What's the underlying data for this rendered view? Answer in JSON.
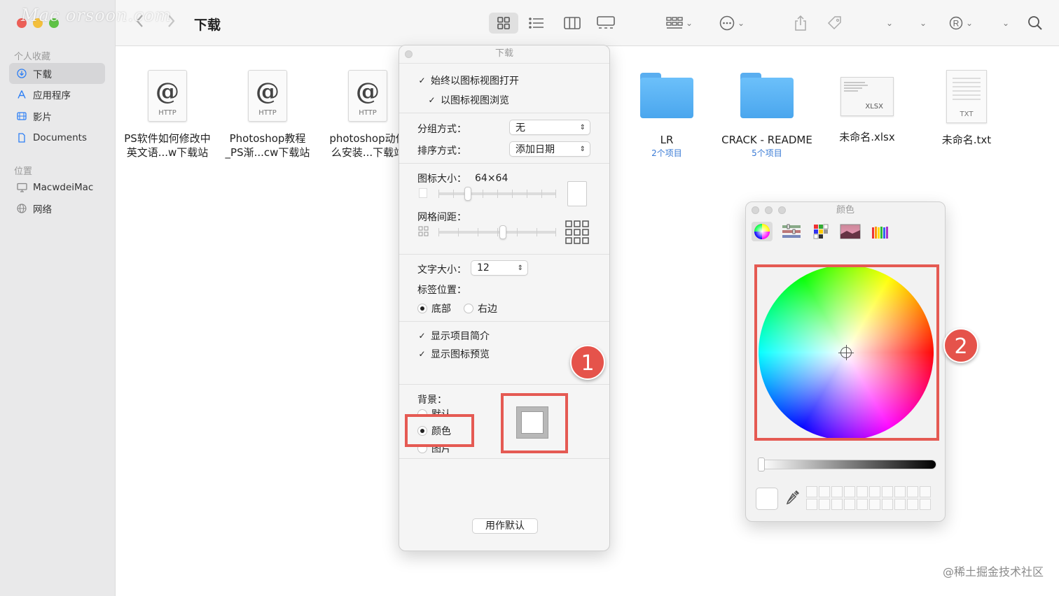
{
  "watermark": "Mac orsoon.com",
  "window": {
    "title": "下载"
  },
  "sidebar": {
    "favorites_label": "个人收藏",
    "locations_label": "位置",
    "items": [
      {
        "label": "下载",
        "icon": "download-icon"
      },
      {
        "label": "应用程序",
        "icon": "applications-icon"
      },
      {
        "label": "影片",
        "icon": "movies-icon"
      },
      {
        "label": "Documents",
        "icon": "document-icon"
      }
    ],
    "locations": [
      {
        "label": "MacwdeiMac",
        "icon": "computer-icon"
      },
      {
        "label": "网络",
        "icon": "network-icon"
      }
    ]
  },
  "toolbar": {
    "icons": [
      "icon-view-icon",
      "list-view-icon",
      "column-view-icon",
      "gallery-view-icon",
      "group-icon",
      "more-actions-icon",
      "share-icon",
      "tag-icon",
      "chevron-down-icon",
      "chevron-down-icon",
      "registered-icon",
      "chevron-down-icon",
      "search-icon"
    ]
  },
  "files": [
    {
      "name1": "PS软件如何修改中",
      "name2": "英文语...w下载站",
      "type": "HTTP"
    },
    {
      "name1": "Photoshop教程",
      "name2": "_PS渐...cw下载站",
      "type": "HTTP"
    },
    {
      "name1": "photoshop动作",
      "name2": "么安装...下载站",
      "type": "HTTP"
    },
    {
      "name1": "LR",
      "sub": "2个项目",
      "type": "folder"
    },
    {
      "name1": "CRACK - README",
      "sub": "5个项目",
      "type": "folder"
    },
    {
      "name1": "未命名.xlsx",
      "type": "XLSX"
    },
    {
      "name1": "未命名.txt",
      "type": "TXT"
    }
  ],
  "view_options": {
    "title": "下载",
    "always_open_icon": "始终以图标视图打开",
    "browse_icon": "以图标视图浏览",
    "group_by_label": "分组方式：",
    "group_by_value": "无",
    "sort_by_label": "排序方式：",
    "sort_by_value": "添加日期",
    "icon_size_label": "图标大小：",
    "icon_size_value": "64×64",
    "icon_size_level": 0.25,
    "grid_spacing_label": "网格间距：",
    "grid_spacing_level": 0.55,
    "text_size_label": "文字大小：",
    "text_size_value": "12",
    "label_pos_label": "标签位置：",
    "label_bottom": "底部",
    "label_right": "右边",
    "show_info": "显示项目简介",
    "show_preview": "显示图标预览",
    "background_label": "背景：",
    "bg_default": "默认",
    "bg_color": "颜色",
    "bg_picture": "图片",
    "use_default": "用作默认"
  },
  "color_panel": {
    "title": "颜色",
    "tabs": [
      "color-wheel-icon",
      "sliders-icon",
      "palettes-icon",
      "image-palette-icon",
      "pencils-icon"
    ]
  },
  "annotations": {
    "badge1": "1",
    "badge2": "2"
  },
  "credit": "@稀土掘金技术社区"
}
